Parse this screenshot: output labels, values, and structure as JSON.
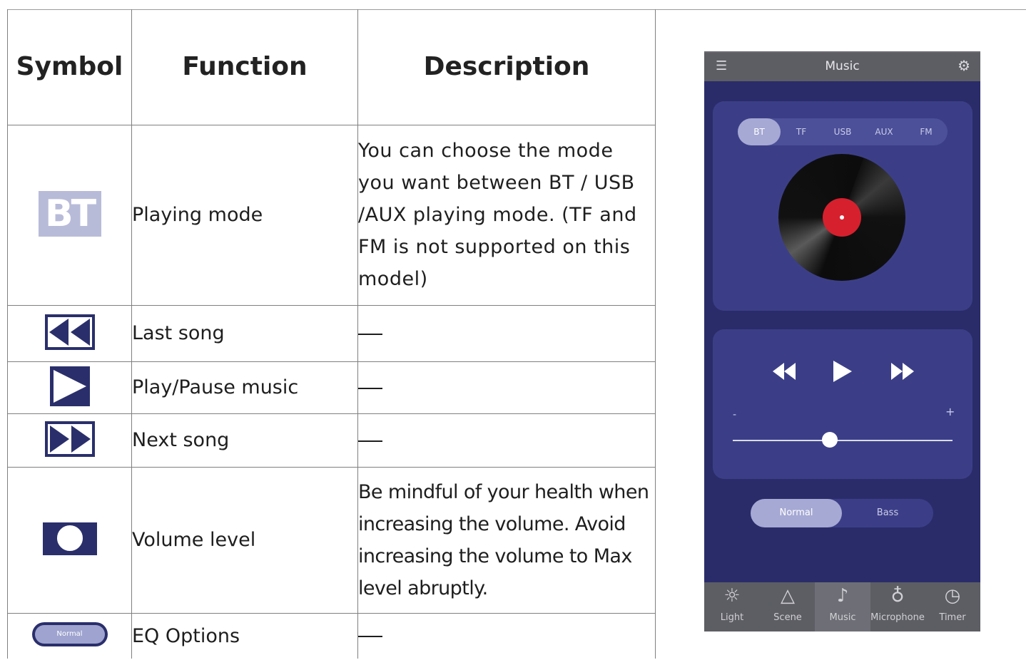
{
  "table": {
    "headers": [
      "Symbol",
      "Function",
      "Description"
    ],
    "rows": [
      {
        "symbol": "BT",
        "function": "Playing mode",
        "description": "You can choose the mode you want between BT / USB /AUX playing mode. (TF and FM is not supported on this model)"
      },
      {
        "symbol": "previous-icon",
        "function": "Last song",
        "description": "—"
      },
      {
        "symbol": "play-icon",
        "function": "Play/Pause music",
        "description": "—"
      },
      {
        "symbol": "next-icon",
        "function": "Next song",
        "description": "—"
      },
      {
        "symbol": "volume-slider-icon",
        "function": "Volume level",
        "description": "Be mindful of your health when increasing the volume. Avoid increasing the volume to Max level abruptly."
      },
      {
        "symbol": "Normal",
        "function": "EQ Options",
        "description": "—"
      }
    ]
  },
  "phone": {
    "title": "Music",
    "modes": [
      "BT",
      "TF",
      "USB",
      "AUX",
      "FM"
    ],
    "active_mode": "BT",
    "volume_min_label": "-",
    "volume_max_label": "+",
    "volume_level": 0.44,
    "eq_options": [
      "Normal",
      "Bass"
    ],
    "active_eq": "Normal",
    "tabs": [
      "Light",
      "Scene",
      "Music",
      "Microphone",
      "Timer"
    ],
    "active_tab": "Music",
    "colors": {
      "background": "#2a2c6a",
      "card": "#3b3e87",
      "accent": "#a6a9d4",
      "record_label": "#d6202e",
      "bar": "#5d5e64"
    }
  }
}
